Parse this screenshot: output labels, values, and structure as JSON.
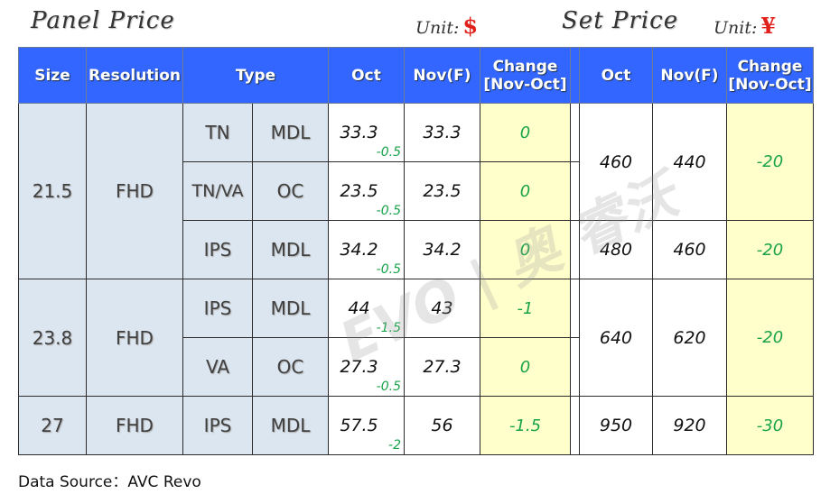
{
  "panel_title": "Panel Price",
  "panel_unit_label": "Unit:",
  "panel_unit_symbol": "$",
  "set_title": "Set Price",
  "set_unit_label": "Unit:",
  "set_unit_symbol": "¥",
  "headers": {
    "size": "Size",
    "resolution": "Resolution",
    "type": "Type",
    "panel_oct": "Oct",
    "panel_nov": "Nov(F)",
    "panel_change": "Change [Nov-Oct]",
    "set_oct": "Oct",
    "set_nov": "Nov(F)",
    "set_change": "Change [Nov-Oct]"
  },
  "groups": [
    {
      "size": "21.5",
      "resolution": "FHD"
    },
    {
      "size": "23.8",
      "resolution": "FHD"
    },
    {
      "size": "27",
      "resolution": "FHD"
    }
  ],
  "rows": [
    {
      "tech": "TN",
      "kind": "MDL",
      "oct": "33.3",
      "oct_delta": "-0.5",
      "nov": "33.3",
      "change": "0"
    },
    {
      "tech": "TN/VA",
      "kind": "OC",
      "oct": "23.5",
      "oct_delta": "-0.5",
      "nov": "23.5",
      "change": "0"
    },
    {
      "tech": "IPS",
      "kind": "MDL",
      "oct": "34.2",
      "oct_delta": "-0.5",
      "nov": "34.2",
      "change": "0"
    },
    {
      "tech": "IPS",
      "kind": "MDL",
      "oct": "44",
      "oct_delta": "-1.5",
      "nov": "43",
      "change": "-1"
    },
    {
      "tech": "VA",
      "kind": "OC",
      "oct": "27.3",
      "oct_delta": "-0.5",
      "nov": "27.3",
      "change": "0"
    },
    {
      "tech": "IPS",
      "kind": "MDL",
      "oct": "57.5",
      "oct_delta": "-2",
      "nov": "56",
      "change": "-1.5"
    }
  ],
  "set_rows": [
    {
      "oct": "460",
      "nov": "440",
      "change": "-20"
    },
    {
      "oct": "480",
      "nov": "460",
      "change": "-20"
    },
    {
      "oct": "640",
      "nov": "620",
      "change": "-20"
    },
    {
      "oct": "950",
      "nov": "920",
      "change": "-30"
    }
  ],
  "watermark": "EVO | 奥 睿沃",
  "footer": "Data Source：AVC Revo",
  "colors": {
    "header_bg": "#3366ff",
    "label_bg": "#dce6f1",
    "change_bg": "#ffffcc",
    "change_text": "#1aa34a",
    "unit_symbol": "#e0201b"
  }
}
